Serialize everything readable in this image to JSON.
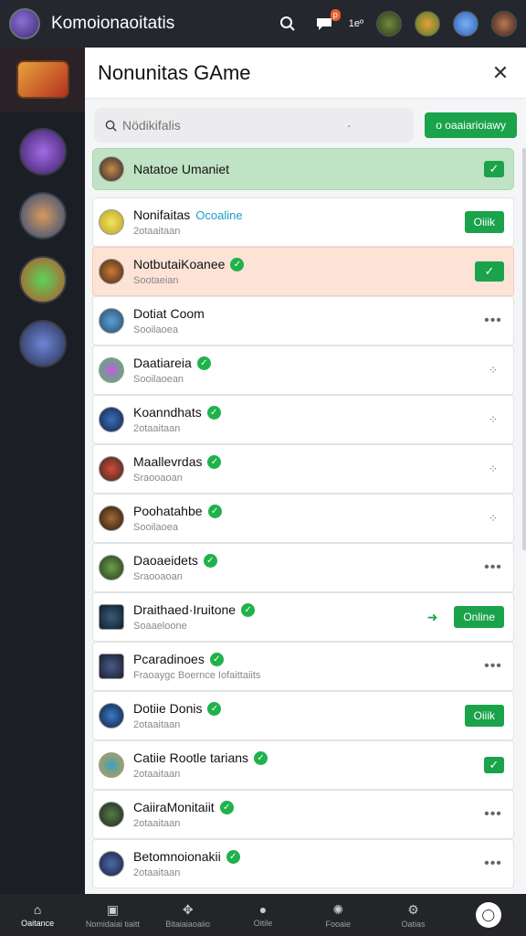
{
  "app": {
    "title": "Komoionaoitatis"
  },
  "topbar": {
    "badge": "p",
    "label": "1eº",
    "icons": [
      "search-icon",
      "chat-icon",
      "avatar",
      "avatar",
      "avatar",
      "avatar"
    ]
  },
  "panel": {
    "title": "Nonunitas GAme",
    "search_placeholder": "Nödikifalis",
    "search_suffix": "·",
    "action_label": "o oaaiarioiawy"
  },
  "rows": [
    {
      "name": "Natatoe Umaniet",
      "sub": "",
      "style": "green",
      "right": "check-small"
    },
    {
      "name": "Nonifaitas",
      "tag": "Ocoaline",
      "sub": "2otaaitaan",
      "style": "plain",
      "right": "button",
      "right_label": "Oiiik"
    },
    {
      "name": "NotbutaiKoanee",
      "verified": true,
      "sub": "Sootaeian",
      "style": "peach",
      "right": "check"
    },
    {
      "name": "Dotiat Coom",
      "sub": "Sooilaoea",
      "style": "plain",
      "right": "more"
    },
    {
      "name": "Daatiareia",
      "verified": true,
      "sub": "Sooilaoean",
      "style": "plain",
      "right": "drag"
    },
    {
      "name": "Koanndhats",
      "verified": true,
      "sub": "2otaaitaan",
      "style": "plain",
      "right": "drag"
    },
    {
      "name": "Maallevrdas",
      "verified": true,
      "sub": "Sraooaoan",
      "style": "plain",
      "right": "drag"
    },
    {
      "name": "Poohatahbe",
      "verified": true,
      "sub": "Sooilaoea",
      "style": "plain",
      "right": "drag"
    },
    {
      "name": "Daoaeidets",
      "verified": true,
      "sub": "Sraooaoan",
      "style": "plain",
      "right": "more"
    },
    {
      "name": "Draithaed·Iruitone",
      "verified": true,
      "sub": "Soaaeloone",
      "style": "plain",
      "right": "button-arrow",
      "right_label": "Online"
    },
    {
      "name": "Pcaradinoes",
      "verified": true,
      "sub": "Fraoaygc Boernce Iofaittaiits",
      "style": "plain",
      "right": "more"
    },
    {
      "name": "Dotiie Donis",
      "verified": true,
      "sub": "2otaaitaan",
      "style": "plain",
      "right": "button",
      "right_label": "Oiiik"
    },
    {
      "name": "Catiie Rootle tarians",
      "verified": true,
      "sub": "2otaaitaan",
      "style": "plain",
      "right": "check-small"
    },
    {
      "name": "CaiiraMonitaiit",
      "verified": true,
      "sub": "2otaaitaan",
      "style": "plain",
      "right": "more"
    },
    {
      "name": "Betomnoionakii",
      "verified": true,
      "sub": "2otaaitaan",
      "style": "plain",
      "right": "more"
    }
  ],
  "bottomnav": [
    {
      "label": "Oaitance",
      "icon": "home-icon",
      "active": true
    },
    {
      "label": "Nomidaiai tiaitt",
      "icon": "box-icon"
    },
    {
      "label": "Bitaiaiaoaiio",
      "icon": "controller-icon"
    },
    {
      "label": "Oitile",
      "icon": "circle-icon"
    },
    {
      "label": "Fooaie",
      "icon": "globe-icon"
    },
    {
      "label": "Oatias",
      "icon": "gear-icon"
    },
    {
      "label": "",
      "icon": "chat-bubble-icon"
    }
  ],
  "colors": {
    "accent": "#1aa34a",
    "highlight_green": "#bfe3c4",
    "highlight_peach": "#fde3d6",
    "topbar": "#25272e"
  }
}
